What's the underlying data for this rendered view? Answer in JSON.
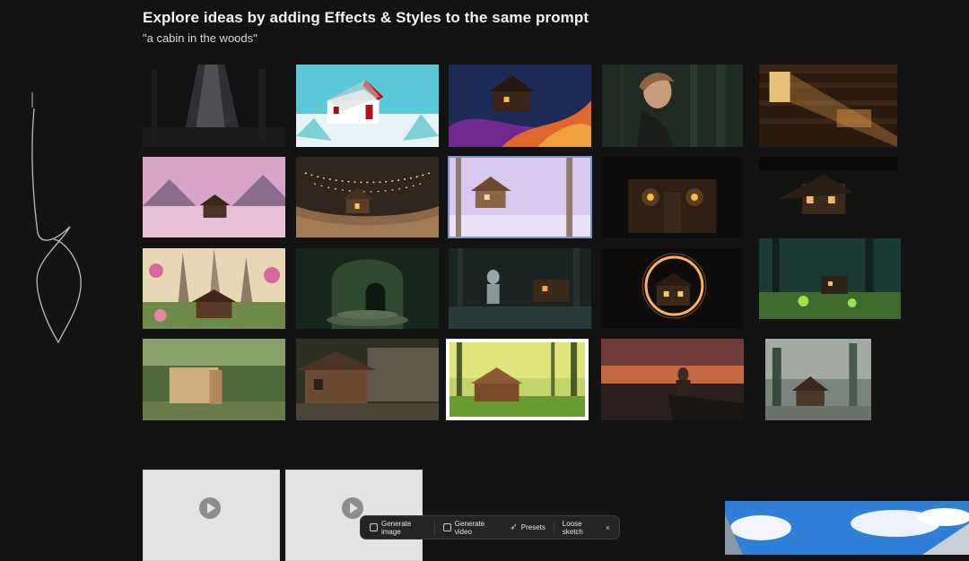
{
  "header": {
    "title": "Explore ideas by adding Effects & Styles to the same prompt",
    "prompt": "\"a cabin in the woods\""
  },
  "gallery": {
    "items": [
      {
        "icon": "spotlight-forest-thumbnail"
      },
      {
        "icon": "snow-cabin-thumbnail"
      },
      {
        "icon": "swirl-cabin-thumbnail"
      },
      {
        "icon": "portrait-forest-thumbnail"
      },
      {
        "icon": "sunlit-interior-thumbnail"
      },
      {
        "icon": "pink-mountain-cabin-thumbnail"
      },
      {
        "icon": "fairy-lights-cabin-thumbnail"
      },
      {
        "icon": "lavender-cabin-thumbnail"
      },
      {
        "icon": "lantern-cabin-thumbnail"
      },
      {
        "icon": "night-cabin-thumbnail"
      },
      {
        "icon": "flower-cabin-thumbnail"
      },
      {
        "icon": "mossy-door-thumbnail"
      },
      {
        "icon": "astronaut-cabin-thumbnail"
      },
      {
        "icon": "portal-cabin-thumbnail"
      },
      {
        "icon": "misty-green-forest-thumbnail"
      },
      {
        "icon": "wood-block-thumbnail"
      },
      {
        "icon": "rustic-shack-thumbnail"
      },
      {
        "icon": "painted-forest-cabin-thumbnail"
      },
      {
        "icon": "sunset-figure-thumbnail"
      },
      {
        "icon": "foggy-cabin-thumbnail"
      }
    ]
  },
  "videos": [
    {
      "icon": "play-icon"
    },
    {
      "icon": "play-icon"
    }
  ],
  "toolbar": {
    "generate_image": "Generate image",
    "generate_video": "Generate video",
    "presets": "Presets",
    "loose_sketch": "Loose sketch",
    "close": "×"
  },
  "colors": {
    "background": "#131313",
    "selected_outline": "#7b95c9",
    "toolbar_bg": "#242424"
  }
}
